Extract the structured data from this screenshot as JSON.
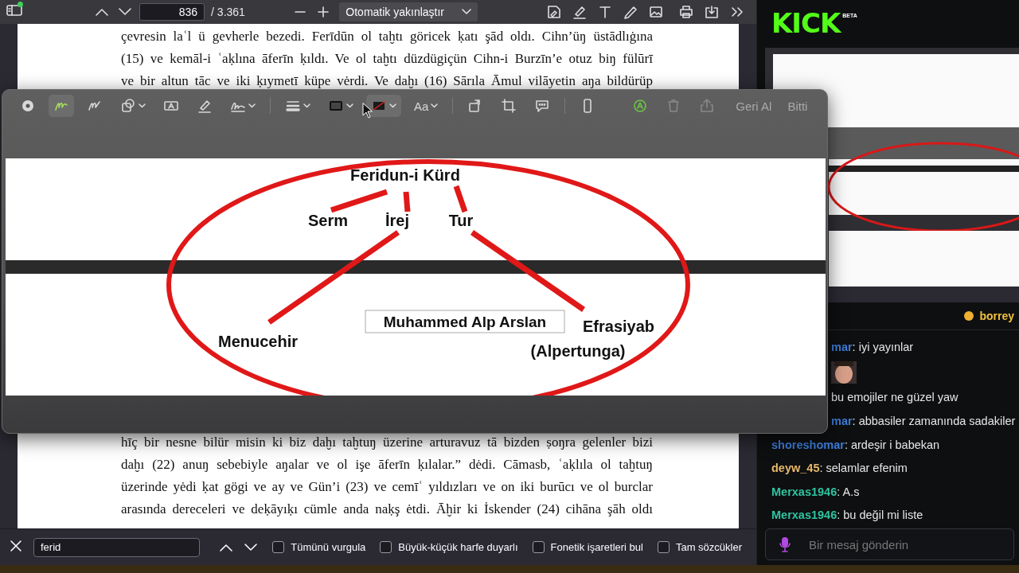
{
  "pdf_toolbar": {
    "page": "836",
    "page_count": "/ 3.361",
    "zoom": "Otomatik yakınlaştır"
  },
  "document": {
    "lines_top": [
      "çevresin laʿl ü gevherle bezedi. Ferīdūn ol taḫtı göricek ḳatı şād oldı. Cihn’üŋ üstādlıġına",
      "(15) ve kemāl-i ʿaḳlına āferīn ḳıldı. Ve ol taḫtı düzdügiçün Cihn-i Burzīn’e otuz biŋ fülūrī",
      "ve bir altun tāc ve iki ḳıymetī küpe vėrdi. Ve daḫı (16) Sārıla Āmul vilāyetin aŋa bildürüp"
    ],
    "lines_bottom": [
      "hīç bir nesne bilür misin ki biz daḫı taḫtuŋ üzerine arturavuz tā bizden ṣoŋra gelenler bizi",
      "daḫı (22) anuŋ sebebiyle aŋalar ve ol işe āferīn ḳılalar.” dėdi. Cāmasb, ʿaḳlıla ol taḫtuŋ",
      "üzerinde yėdi ḳat gögi ve ay ve Gün’i (23) ve cemīʿ yıldızları ve on iki burūcı ve ol burclar",
      "arasında dereceleri ve deḳāyıḳı cümle anda naḳş ėtdi. Āḫir ki İskender (24) cihāna şāh oldı"
    ]
  },
  "markup_window": {
    "font_button": "Aa",
    "undo": "Geri Al",
    "done": "Bitti",
    "diagram": {
      "labels": [
        "Feridun-i Kürd",
        "Serm",
        "İrej",
        "Tur",
        "Menucehir",
        "Efrasiyab",
        "(Alpertunga)"
      ],
      "text_box": "Muhammed Alp Arslan"
    }
  },
  "find_bar": {
    "query": "ferid",
    "options": [
      {
        "label": "Tümünü vurgula",
        "checked": false
      },
      {
        "label": "Büyük-küçük harfe duyarlı",
        "checked": false
      },
      {
        "label": "Fonetik işaretleri bul",
        "checked": false
      },
      {
        "label": "Tam sözcükler",
        "checked": false
      }
    ]
  },
  "stream": {
    "logo": "KICK",
    "logo_badge": "BETA"
  },
  "chat": {
    "pinned": "borrey",
    "messages": [
      {
        "kind": "cut",
        "user": "mar",
        "color": "#3c7dd9",
        "text": ": iyi yayınlar"
      },
      {
        "kind": "emote"
      },
      {
        "kind": "cut",
        "text": "bu emojiler ne güzel yaw"
      },
      {
        "kind": "cut",
        "user": "mar",
        "color": "#3c7dd9",
        "text": ": abbasiler zamanında sadakiler"
      },
      {
        "kind": "full",
        "user": "shoreshomar",
        "color": "#3c7dd9",
        "text": ": ardeşir i babekan"
      },
      {
        "kind": "full",
        "user": "deyw_45",
        "color": "#e8b86a",
        "text": ": selamlar efenim"
      },
      {
        "kind": "full",
        "user": "Merxas1946",
        "color": "#2ec4a0",
        "text": ": A.s"
      },
      {
        "kind": "full",
        "user": "Merxas1946",
        "color": "#2ec4a0",
        "text": ": bu değil mi liste"
      }
    ],
    "placeholder": "Bir mesaj gönderin"
  }
}
